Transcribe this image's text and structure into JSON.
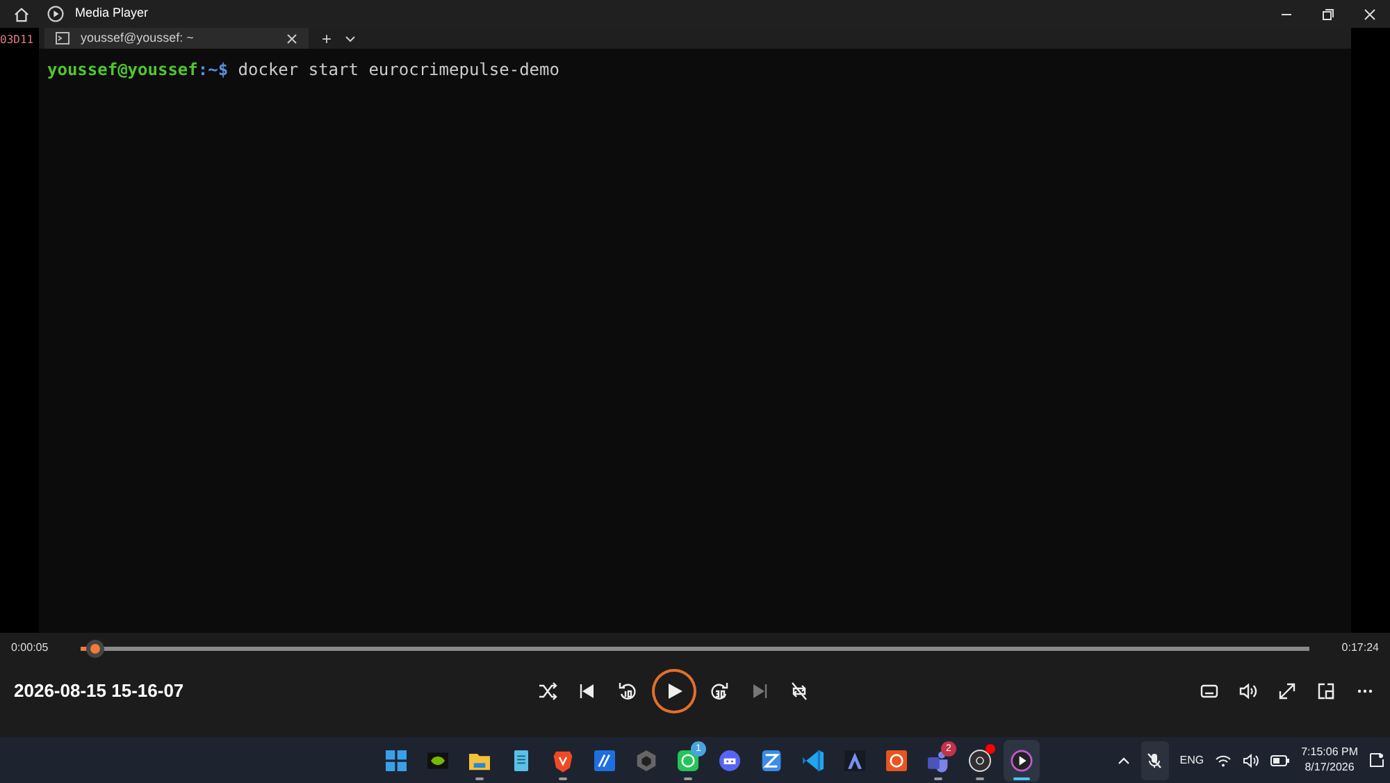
{
  "window": {
    "title": "Media Player"
  },
  "video": {
    "side_text": "03D11",
    "terminal": {
      "tab_title": "youssef@youssef: ~",
      "new_tab": "+",
      "lines": [
        {
          "user": "youssef@youssef",
          "path": ":~$",
          "command": "docker start eurocrimepulse-demo"
        }
      ]
    }
  },
  "player": {
    "elapsed": "0:00:05",
    "duration": "0:17:24",
    "level": 0.011,
    "media_title": "2026-08-15 15-16-07",
    "controls": [
      {
        "kind": "shuffle",
        "disabled": false
      },
      {
        "kind": "previous",
        "disabled": false
      },
      {
        "kind": "back10",
        "disabled": false
      },
      {
        "kind": "play",
        "disabled": false
      },
      {
        "kind": "forward30",
        "disabled": false
      },
      {
        "kind": "next",
        "disabled": true
      },
      {
        "kind": "repeat",
        "disabled": false
      }
    ],
    "right_controls": [
      {
        "kind": "subtitles"
      },
      {
        "kind": "volume"
      },
      {
        "kind": "fullscreen"
      },
      {
        "kind": "miniplayer"
      },
      {
        "kind": "more"
      }
    ]
  },
  "taskbar": {
    "apps": [
      {
        "kind": "start",
        "running": false,
        "selected": false
      },
      {
        "kind": "chip",
        "running": false,
        "selected": false
      },
      {
        "kind": "folder",
        "running": true,
        "selected": false
      },
      {
        "kind": "notepad",
        "running": false,
        "selected": false
      },
      {
        "kind": "shield",
        "running": true,
        "selected": false
      },
      {
        "kind": "editor",
        "running": false,
        "selected": false
      },
      {
        "kind": "cube",
        "running": false,
        "selected": false
      },
      {
        "kind": "chat",
        "running": true,
        "selected": false,
        "badge": "1"
      },
      {
        "kind": "gamepad",
        "running": false,
        "selected": false
      },
      {
        "kind": "stack",
        "running": false,
        "selected": false
      },
      {
        "kind": "code",
        "running": false,
        "selected": false
      },
      {
        "kind": "peak",
        "running": false,
        "selected": false
      },
      {
        "kind": "ring",
        "running": false,
        "selected": false
      },
      {
        "kind": "team",
        "running": true,
        "selected": false,
        "badge": "2"
      },
      {
        "kind": "aperture",
        "running": true,
        "selected": false,
        "dot": true
      },
      {
        "kind": "player",
        "running": true,
        "selected": true
      }
    ],
    "tray": {
      "language": "ENG",
      "time": "7:15:06 PM",
      "date": "8/17/2026",
      "mic_muted": true
    }
  }
}
